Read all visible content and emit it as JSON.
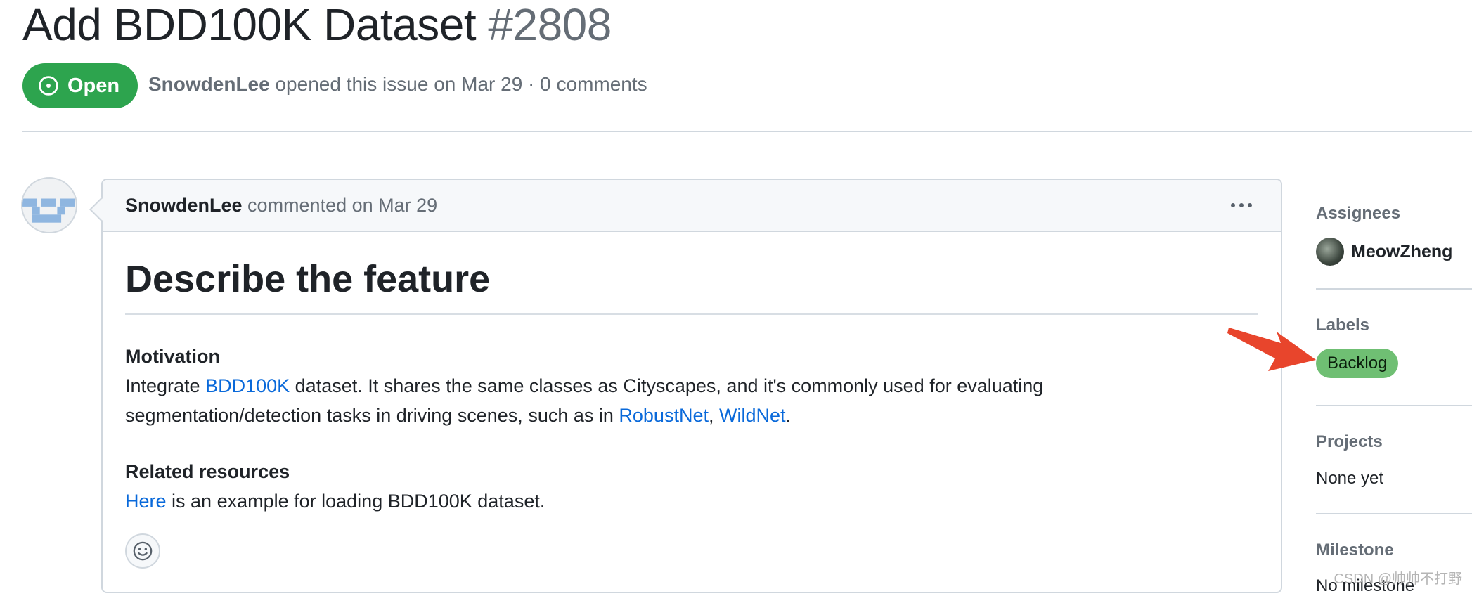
{
  "issue": {
    "title": "Add BDD100K Dataset",
    "number": "#2808",
    "state": "Open",
    "author": "SnowdenLee",
    "meta_text": "opened this issue on Mar 29 · 0 comments"
  },
  "comment": {
    "author": "SnowdenLee",
    "action": "commented on Mar 29",
    "heading": "Describe the feature",
    "motivation_title": "Motivation",
    "motivation_p1_before": "Integrate ",
    "motivation_link1": "BDD100K",
    "motivation_p1_after": " dataset. It shares the same classes as Cityscapes, and it's commonly used for evaluating",
    "motivation_p2_before": "segmentation/detection tasks in driving scenes, such as in ",
    "motivation_link2": "RobustNet",
    "motivation_sep": ", ",
    "motivation_link3": "WildNet",
    "motivation_end": ".",
    "related_title": "Related resources",
    "related_link": "Here",
    "related_text": " is an example for loading BDD100K dataset."
  },
  "sidebar": {
    "assignees_title": "Assignees",
    "assignee_name": "MeowZheng",
    "labels_title": "Labels",
    "label": "Backlog",
    "projects_title": "Projects",
    "projects_value": "None yet",
    "milestone_title": "Milestone",
    "milestone_value": "No milestone"
  },
  "watermark": "CSDN @帅帅不打野",
  "colors": {
    "open_badge": "#2da44e",
    "link": "#0969da",
    "label_backlog": "#6fbf73",
    "annotation_arrow": "#e8452c"
  },
  "icons": {
    "state": "issue-opened-icon",
    "menu": "kebab-horizontal-icon",
    "reaction": "smiley-icon"
  }
}
